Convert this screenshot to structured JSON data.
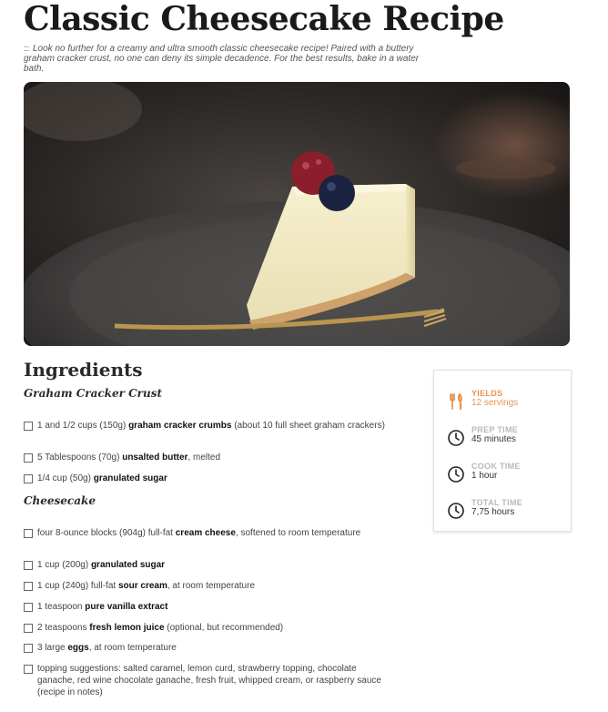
{
  "recipe": {
    "title": "Classic Cheesecake Recipe",
    "intro": "Look no further for a creamy and ultra smooth classic cheesecake recipe! Paired with a buttery graham cracker crust, no one can deny its simple decadence. For the best results, bake in a water bath."
  },
  "ingredients": {
    "heading": "Ingredients",
    "sections": [
      {
        "title": "Graham Cracker Crust",
        "items": [
          {
            "pre": "1 and 1/2 cups (150g) ",
            "bold": "graham cracker crumbs",
            "post": " (about 10 full sheet graham crackers)"
          },
          {
            "pre": "5 Tablespoons (70g) ",
            "bold": "unsalted butter",
            "post": ", melted"
          },
          {
            "pre": "1/4 cup (50g) ",
            "bold": "granulated sugar",
            "post": ""
          }
        ]
      },
      {
        "title": "Cheesecake",
        "items": [
          {
            "pre": "four 8-ounce blocks (904g) full-fat ",
            "bold": "cream cheese",
            "post": ", softened to room temperature"
          },
          {
            "pre": "1 cup (200g) ",
            "bold": "granulated sugar",
            "post": ""
          },
          {
            "pre": "1 cup (240g) full-fat ",
            "bold": "sour cream",
            "post": ", at room temperature"
          },
          {
            "pre": "1 teaspoon ",
            "bold": "pure vanilla extract",
            "post": ""
          },
          {
            "pre": "2 teaspoons ",
            "bold": "fresh lemon juice",
            "post": " (optional, but recommended)"
          },
          {
            "pre": "3 large ",
            "bold": "eggs",
            "post": ", at room temperature"
          },
          {
            "pre": "topping suggestions: salted caramel, lemon curd, strawberry topping, chocolate ganache, red wine chocolate ganache, fresh fruit, whipped cream, or raspberry sauce ",
            "bold": "",
            "post": "(recipe in notes)"
          }
        ]
      }
    ]
  },
  "stats": [
    {
      "label": "YIELDS",
      "value": "12 servings",
      "icon": "fork-knife-icon"
    },
    {
      "label": "PREP TIME",
      "value": "45 minutes",
      "icon": "clock-icon"
    },
    {
      "label": "COOK TIME",
      "value": "1 hour",
      "icon": "clock-icon"
    },
    {
      "label": "TOTAL TIME",
      "value": "7,75 hours",
      "icon": "clock-icon"
    }
  ],
  "colors": {
    "accent": "#e89552",
    "heading": "#1a1a1a"
  }
}
